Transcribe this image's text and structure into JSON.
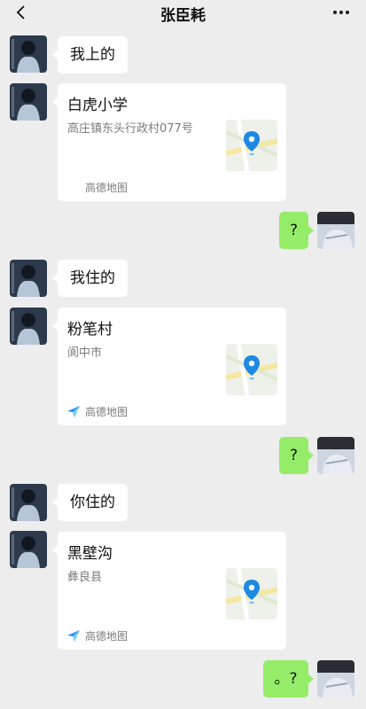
{
  "header": {
    "title": "张臣耗"
  },
  "messages": [
    {
      "kind": "text",
      "side": "left",
      "text": "我上的"
    },
    {
      "kind": "location",
      "side": "left",
      "name": "白虎小学",
      "address": "高庄镇东头行政村077号",
      "source": "高德地图",
      "source_icon": "amap-logo-icon",
      "show_source_icon": false
    },
    {
      "kind": "text",
      "side": "right",
      "text": "?"
    },
    {
      "kind": "text",
      "side": "left",
      "text": "我住的"
    },
    {
      "kind": "location",
      "side": "left",
      "name": "粉笔村",
      "address": "阆中市",
      "source": "高德地图",
      "source_icon": "amap-logo-icon",
      "show_source_icon": true
    },
    {
      "kind": "text",
      "side": "right",
      "text": "?"
    },
    {
      "kind": "text",
      "side": "left",
      "text": "你住的"
    },
    {
      "kind": "location",
      "side": "left",
      "name": "黑壁沟",
      "address": "彝良县",
      "source": "高德地图",
      "source_icon": "amap-logo-icon",
      "show_source_icon": true
    },
    {
      "kind": "text",
      "side": "right",
      "text": "。?"
    }
  ],
  "colors": {
    "background": "#ededed",
    "my_bubble": "#95ec69",
    "their_bubble": "#ffffff",
    "map_pin": "#1e88e5"
  }
}
